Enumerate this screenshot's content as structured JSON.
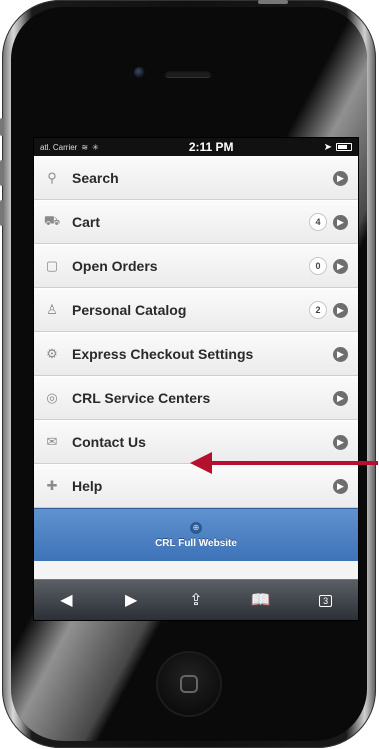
{
  "status_bar": {
    "carrier": "atl. Carrier",
    "time": "2:11 PM"
  },
  "menu": [
    {
      "label": "Search",
      "icon": "search-icon"
    },
    {
      "label": "Cart",
      "icon": "cart-icon",
      "count": "4"
    },
    {
      "label": "Open Orders",
      "icon": "clipboard-icon",
      "count": "0"
    },
    {
      "label": "Personal Catalog",
      "icon": "person-icon",
      "count": "2"
    },
    {
      "label": "Express Checkout Settings",
      "icon": "gear-icon"
    },
    {
      "label": "CRL Service Centers",
      "icon": "globe-icon"
    },
    {
      "label": "Contact Us",
      "icon": "envelope-icon"
    },
    {
      "label": "Help",
      "icon": "plus-icon"
    }
  ],
  "footer": {
    "label": "CRL Full Website",
    "icon": "globe-icon"
  },
  "toolbar": {
    "tabs_count": "3"
  },
  "colors": {
    "accent_blue": "#4a7fc1",
    "annotation_red": "#b3112e"
  }
}
